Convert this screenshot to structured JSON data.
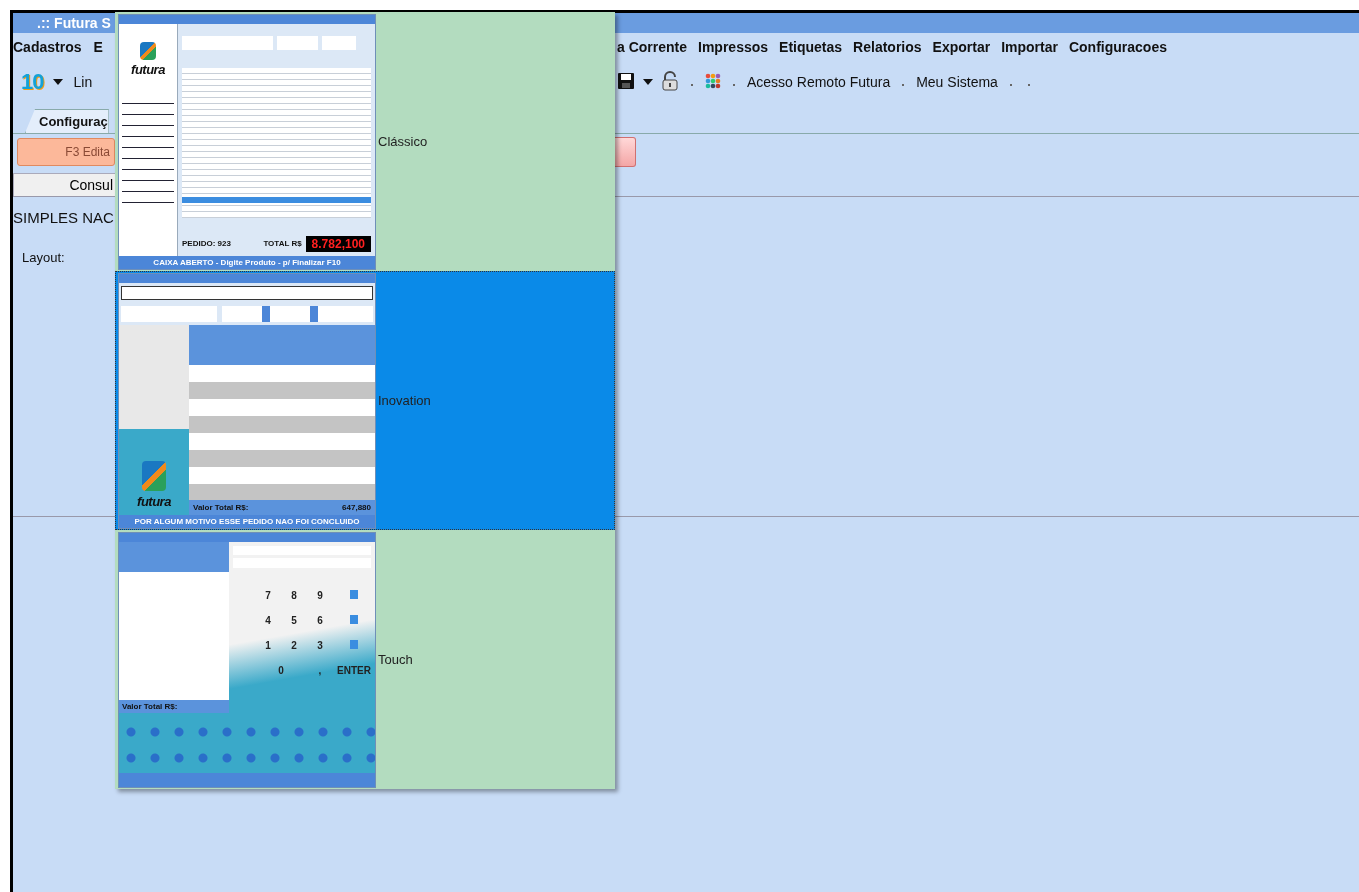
{
  "window": {
    "title": ".:: Futura S"
  },
  "menu": {
    "left": [
      "Cadastros",
      "E"
    ],
    "right": [
      "a Corrente",
      "Impressos",
      "Etiquetas",
      "Relatorios",
      "Exportar",
      "Importar",
      "Configuracoes"
    ]
  },
  "toolbar": {
    "left": [
      {
        "kind": "logo",
        "text": "10"
      },
      {
        "kind": "caret"
      },
      {
        "kind": "text",
        "text": "Lin"
      }
    ],
    "right": [
      {
        "kind": "save"
      },
      {
        "kind": "caret"
      },
      {
        "kind": "lock"
      },
      {
        "kind": "dot"
      },
      {
        "kind": "grid"
      },
      {
        "kind": "dot"
      },
      {
        "kind": "text",
        "text": "Acesso Remoto Futura"
      },
      {
        "kind": "dot"
      },
      {
        "kind": "text",
        "text": "Meu Sistema"
      },
      {
        "kind": "dot"
      },
      {
        "kind": "dot"
      }
    ]
  },
  "tabs": [
    {
      "label": "Configuraç",
      "selected": true
    }
  ],
  "edit_button": "F3 Edita",
  "query_button": "Consul",
  "section_title": "SIMPLES NAC",
  "layout_label": "Layout:",
  "layout_dropdown": {
    "options": [
      {
        "label": "Clássico",
        "selected": false,
        "preview": {
          "kind": "classic",
          "logo": "futura",
          "order": "PEDIDO: 923",
          "total_label": "TOTAL R$",
          "total": "8.782,100",
          "status": "CAIXA ABERTO - Digite Produto - p/ Finalizar F10"
        }
      },
      {
        "label": "Inovation",
        "selected": true,
        "preview": {
          "kind": "inovation",
          "logo": "futura",
          "total_label": "Valor Total R$:",
          "total": "647,880",
          "status": "POR ALGUM MOTIVO ESSE PEDIDO NAO FOI CONCLUIDO"
        }
      },
      {
        "label": "Touch",
        "selected": false,
        "preview": {
          "kind": "touch",
          "keys": [
            "7",
            "8",
            "9",
            "4",
            "5",
            "6",
            "1",
            "2",
            "3",
            "0",
            ",",
            "ENTER"
          ],
          "total_label": "Valor Total R$:"
        }
      }
    ]
  }
}
